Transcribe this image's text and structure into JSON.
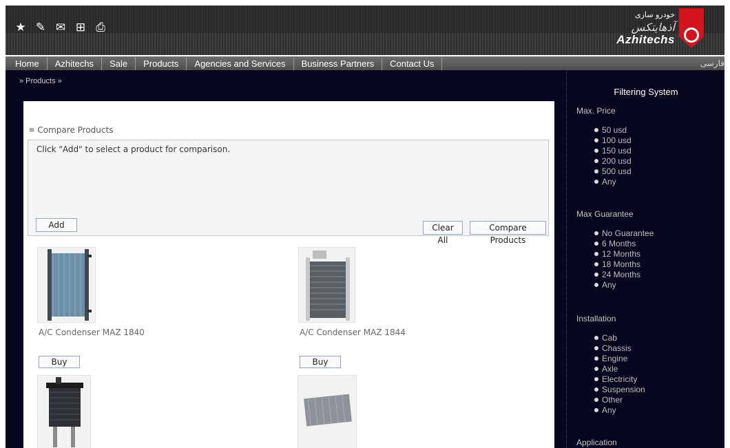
{
  "header": {
    "tool_icons": [
      "star-icon",
      "edit-icon",
      "mail-icon",
      "sitemap-icon",
      "print-icon"
    ],
    "tool_glyphs": [
      "★",
      "✎",
      "✉",
      "⊞",
      "⎙"
    ],
    "logo": {
      "persian_top": "خودرو سازی",
      "persian_brand": "آذهایتکس",
      "english": "Azhitechs"
    }
  },
  "nav": {
    "items": [
      "Home",
      "Azhitechs",
      "Sale",
      "Products",
      "Agencies and Services",
      "Business Partners",
      "Contact Us"
    ],
    "lang": "فارسی"
  },
  "breadcrumb": "» Products »",
  "compare": {
    "heading": "Compare Products",
    "collapse_glyph": "≡",
    "message": "Click \"Add\" to select a product for comparison.",
    "add_label": "Add",
    "clear_label": "Clear All",
    "compare_label": "Compare Products"
  },
  "products": [
    {
      "name": "A/C Condenser MAZ 1840",
      "buy_label": "Buy"
    },
    {
      "name": "A/C Condenser MAZ 1844",
      "buy_label": "Buy"
    },
    {
      "name": "",
      "buy_label": ""
    },
    {
      "name": "",
      "buy_label": ""
    }
  ],
  "sidebar": {
    "title": "Filtering System",
    "groups": [
      {
        "heading": "Max. Price",
        "options": [
          "50 usd",
          "100 usd",
          "150 usd",
          "200 usd",
          "500 usd",
          "Any"
        ]
      },
      {
        "heading": "Max Guarantee",
        "options": [
          "No Guarantee",
          "6 Months",
          "12 Months",
          "18 Months",
          "24 Months",
          "Any"
        ]
      },
      {
        "heading": "Installation",
        "options": [
          "Cab",
          "Chassis",
          "Engine",
          "Axle",
          "Electricity",
          "Suspension",
          "Other",
          "Any"
        ]
      },
      {
        "heading": "Application",
        "options": []
      }
    ]
  },
  "colors": {
    "background": "#07061f",
    "accent_red": "#d4141c",
    "button_border": "#8fa6c6"
  }
}
